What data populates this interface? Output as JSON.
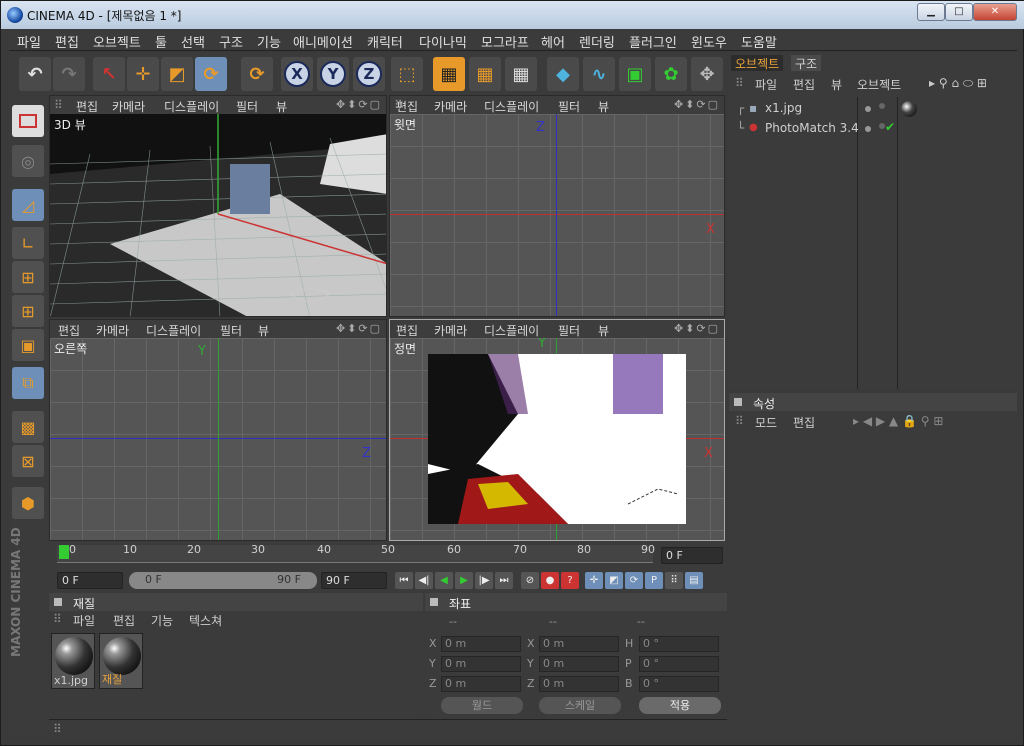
{
  "window": {
    "title": "CINEMA 4D - [제목없음 1 *]",
    "min": "▁",
    "max": "□",
    "close": "✕"
  },
  "menu": [
    "파일",
    "편집",
    "오브젝트",
    "툴",
    "선택",
    "구조",
    "기능",
    "애니메이션",
    "캐릭터",
    "다이나믹",
    "모그라프",
    "헤어",
    "렌더링",
    "플러그인",
    "윈도우",
    "도움말"
  ],
  "toolbar": {
    "undo": "↶",
    "redo": "↷",
    "select": "↖",
    "move": "✛",
    "scale": "◩",
    "rotate": "⟳",
    "rotate2": "⟳",
    "x": "X",
    "y": "Y",
    "z": "Z",
    "coord": "⬚",
    "render1": "▦",
    "render2": "▦",
    "render3": "▦",
    "cube": "◆",
    "spline": "∿",
    "nurbs": "▣",
    "flower": "✿",
    "deform": "✥"
  },
  "viewports": [
    {
      "menu": [
        "편집",
        "카메라",
        "디스플레이",
        "필터",
        "뷰"
      ],
      "label": "3D 뷰"
    },
    {
      "menu": [
        "편집",
        "카메라",
        "디스플레이",
        "필터",
        "뷰"
      ],
      "label": "윗면",
      "axis1": "Z",
      "axis2": "X"
    },
    {
      "menu": [
        "편집",
        "카메라",
        "디스플레이",
        "필터",
        "뷰"
      ],
      "label": "오른쪽",
      "axis1": "Y",
      "axis2": "Z"
    },
    {
      "menu": [
        "편집",
        "카메라",
        "디스플레이",
        "필터",
        "뷰"
      ],
      "label": "정면",
      "axis1": "Y",
      "axis2": "X"
    }
  ],
  "timeline": {
    "ticks": [
      "0",
      "10",
      "20",
      "30",
      "40",
      "50",
      "60",
      "70",
      "80",
      "90"
    ],
    "current": "0 F"
  },
  "transport": {
    "start": "0 F",
    "range_start": "0 F",
    "range_end": "90 F",
    "end": "90 F"
  },
  "materials": {
    "title": "재질",
    "menu": [
      "파일",
      "편집",
      "기능",
      "텍스쳐"
    ],
    "items": [
      {
        "name": "x1.jpg"
      },
      {
        "name": "재질"
      }
    ]
  },
  "coords": {
    "title": "좌표",
    "headers": [
      "--",
      "--",
      "--"
    ],
    "rows": [
      {
        "a": "X",
        "av": "0 m",
        "b": "X",
        "bv": "0 m",
        "c": "H",
        "cv": "0 °"
      },
      {
        "a": "Y",
        "av": "0 m",
        "b": "Y",
        "bv": "0 m",
        "c": "P",
        "cv": "0 °"
      },
      {
        "a": "Z",
        "av": "0 m",
        "b": "Z",
        "bv": "0 m",
        "c": "B",
        "cv": "0 °"
      }
    ],
    "world": "월드",
    "scale": "스케일",
    "apply": "적용"
  },
  "objects": {
    "tabs": [
      "오브젝트",
      "구조"
    ],
    "menu": [
      "파일",
      "편집",
      "뷰",
      "오브젝트"
    ],
    "items": [
      {
        "name": "x1.jpg"
      },
      {
        "name": "PhotoMatch 3.4"
      }
    ]
  },
  "attributes": {
    "title": "속성",
    "menu": [
      "모드",
      "편집"
    ]
  },
  "brand": "MAXON CINEMA 4D",
  "colors": {
    "accent": "#e9a23b",
    "x_axis": "#c03030",
    "y_axis": "#30a030",
    "z_axis": "#3030c0"
  }
}
